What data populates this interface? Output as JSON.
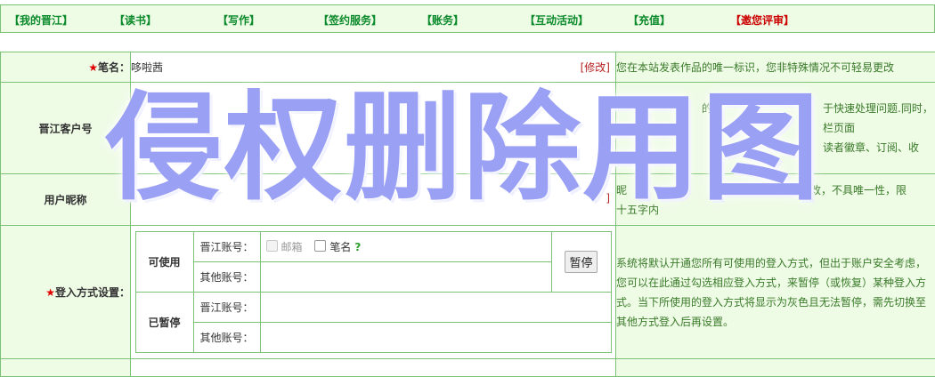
{
  "nav": {
    "items": [
      {
        "label": "【我的晋江】"
      },
      {
        "label": "【读书】"
      },
      {
        "label": "【写作】"
      },
      {
        "label": "【签约服务】"
      },
      {
        "label": "【账务】"
      },
      {
        "label": "【互动活动】"
      },
      {
        "label": "【充值】"
      },
      {
        "label": "【邀您评审】"
      }
    ]
  },
  "form": {
    "pen_name": {
      "label": "笔名：",
      "value": "哆啦茜",
      "modify": "[修改]",
      "hint": "您在本站发表作品的唯一标识，您非特殊情况不可轻易更改"
    },
    "customer_id": {
      "label": "晋江客户号",
      "hint_line1": "的",
      "hint_line1b": "于快速处理问题.同时，",
      "hint_line2": "栏页面",
      "hint_line3": "读者徽章、订阅、收"
    },
    "nickname": {
      "label": "用户昵称",
      "modify": "]",
      "hint_a": "昵",
      "hint_b": "修改，不具唯一性，限",
      "hint_c": "十五字内"
    },
    "login": {
      "label": "登入方式设置：",
      "available_label": "可使用",
      "paused_label": "已暂停",
      "jj_account": "晋江账号：",
      "other_account": "其他账号：",
      "email_option": "邮箱",
      "penname_option": "笔名",
      "help": "?",
      "pause_button": "暂停",
      "hint": "系统将默认开通您所有可使用的登入方式，但出于账户安全考虑，您可以在此通过勾选相应登入方式，来暂停（或恢复）某种登入方式。当下所使用的登入方式将显示为灰色且无法暂停，需先切换至其他方式登入后再设置。"
    }
  },
  "watermark": "侵权删除用图",
  "colors": {
    "nav_green": "#0a8a2a",
    "highlight_red": "#cc0000",
    "cell_bg": "#eefbe5",
    "border": "#7cc276"
  }
}
